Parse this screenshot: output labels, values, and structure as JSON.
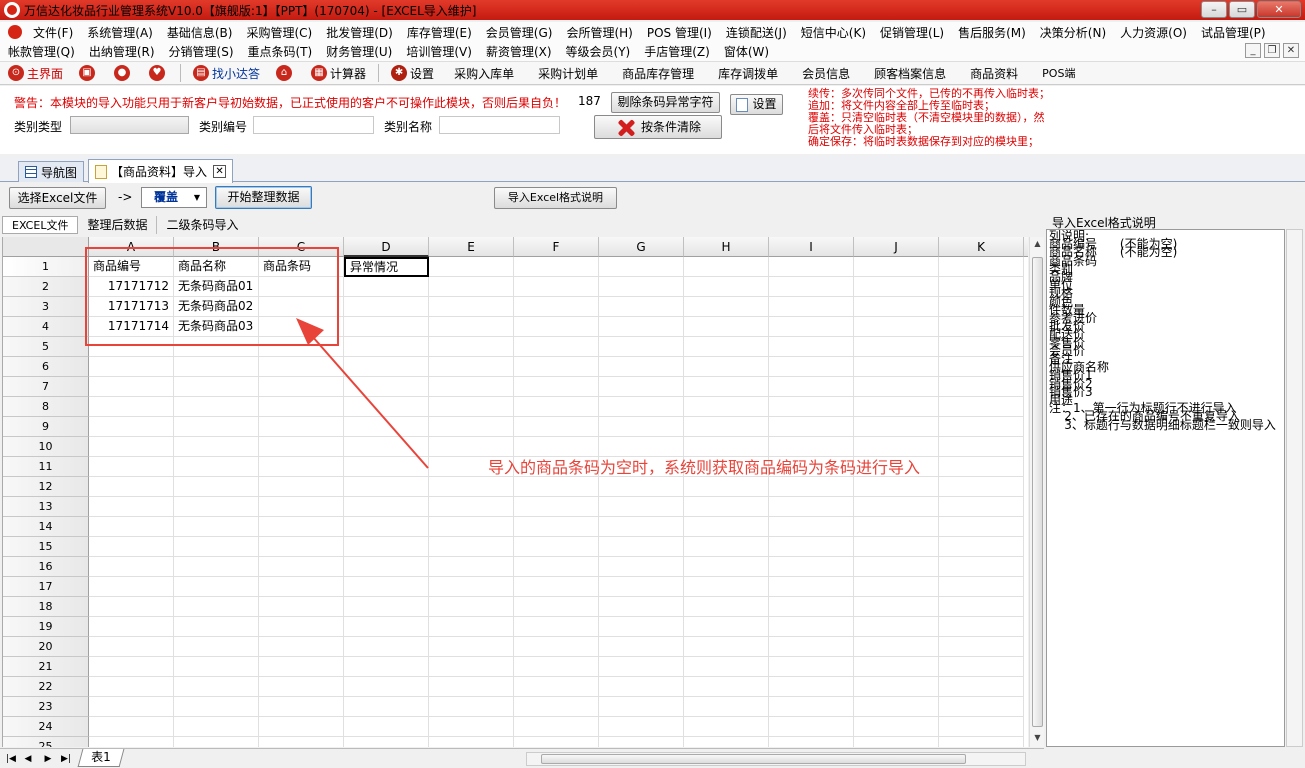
{
  "window": {
    "title": "万信达化妆品行业管理系统V10.0【旗舰版:1】【PPT】(170704) - [EXCEL导入维护]",
    "min": "–",
    "max": "▭",
    "close": "✕"
  },
  "menu1": [
    "文件(F)",
    "系统管理(A)",
    "基础信息(B)",
    "采购管理(C)",
    "批发管理(D)",
    "库存管理(E)",
    "会员管理(G)",
    "会所管理(H)",
    "POS 管理(I)",
    "连锁配送(J)",
    "短信中心(K)",
    "促销管理(L)",
    "售后服务(M)",
    "决策分析(N)",
    "人力资源(O)",
    "试品管理(P)"
  ],
  "menu2": [
    "帐款管理(Q)",
    "出纳管理(R)",
    "分销管理(S)",
    "重点条码(T)",
    "财务管理(U)",
    "培训管理(V)",
    "薪资管理(X)",
    "等级会员(Y)",
    "手店管理(Z)",
    "窗体(W)"
  ],
  "toolbar": {
    "home": "主界面",
    "help": "找小达答",
    "calc": "计算器",
    "settings": "设置",
    "links": [
      "采购入库单",
      "采购计划单",
      "商品库存管理",
      "库存调拨单",
      "会员信息",
      "顾客档案信息",
      "商品资料",
      "POS端"
    ]
  },
  "top": {
    "warning": "警告：本模块的导入功能只用于新客户导初始数据，已正式使用的客户不可操作此模块，否则后果自负！",
    "count": "187",
    "btn_exclude": "剔除条码异常字符",
    "btn_settings": "设置",
    "btn_clear": "按条件清除",
    "cat_type_label": "类别类型",
    "cat_code_label": "类别编号",
    "cat_name_label": "类别名称",
    "notes": [
      "续传：多次传同个文件，已传的不再传入临时表；",
      "追加：将文件内容全部上传至临时表；",
      "覆盖：只清空临时表（不清空模块里的数据），然",
      "后将文件传入临时表；",
      "确定保存：将临时表数据保存到对应的模块里；"
    ]
  },
  "tabs": {
    "nav": "导航图",
    "active": "【商品资料】导入"
  },
  "actions": {
    "choose_file": "选择Excel文件",
    "arrow": "->",
    "mode": "覆盖",
    "start": "开始整理数据",
    "format_help": "导入Excel格式说明"
  },
  "subtabs": [
    "EXCEL文件",
    "整理后数据",
    "二级条码导入"
  ],
  "sheet": {
    "columns": [
      "A",
      "B",
      "C",
      "D",
      "E",
      "F",
      "G",
      "H",
      "I",
      "J",
      "K"
    ],
    "rows": [
      "1",
      "2",
      "3",
      "4",
      "5",
      "6",
      "7",
      "8",
      "9",
      "10",
      "11",
      "12",
      "13",
      "14",
      "15",
      "16",
      "17",
      "18",
      "19",
      "20",
      "21",
      "22",
      "23",
      "24",
      "25"
    ],
    "header_row": [
      "商品编号",
      "商品名称",
      "商品条码",
      "异常情况"
    ],
    "data": [
      {
        "code": "17171712",
        "name": "无条码商品01"
      },
      {
        "code": "17171713",
        "name": "无条码商品02"
      },
      {
        "code": "17171714",
        "name": "无条码商品03"
      }
    ],
    "sheet_name": "表1"
  },
  "annotation": "导入的商品条码为空时，系统则获取商品编码为条码进行导入",
  "right": {
    "label": "导入Excel格式说明",
    "lines": [
      "列说明:",
      "商品编号      (不能为空)",
      "商品名称      (不能为空)",
      "商品条码",
      "类别",
      "品牌",
      "单位",
      "规格",
      "颜色",
      "件数量",
      "参考进价",
      "批发价",
      "配送价",
      "零售价",
      "会员价",
      "备注",
      "供应商名称",
      "销售价1",
      "销售价2",
      "销售价3",
      "用途",
      "",
      "注：1、第一行为标题行不进行导入",
      "    2、已存在的商品编号不重复导入",
      "    3、标题行与数据明细标题栏一致则导入"
    ]
  }
}
